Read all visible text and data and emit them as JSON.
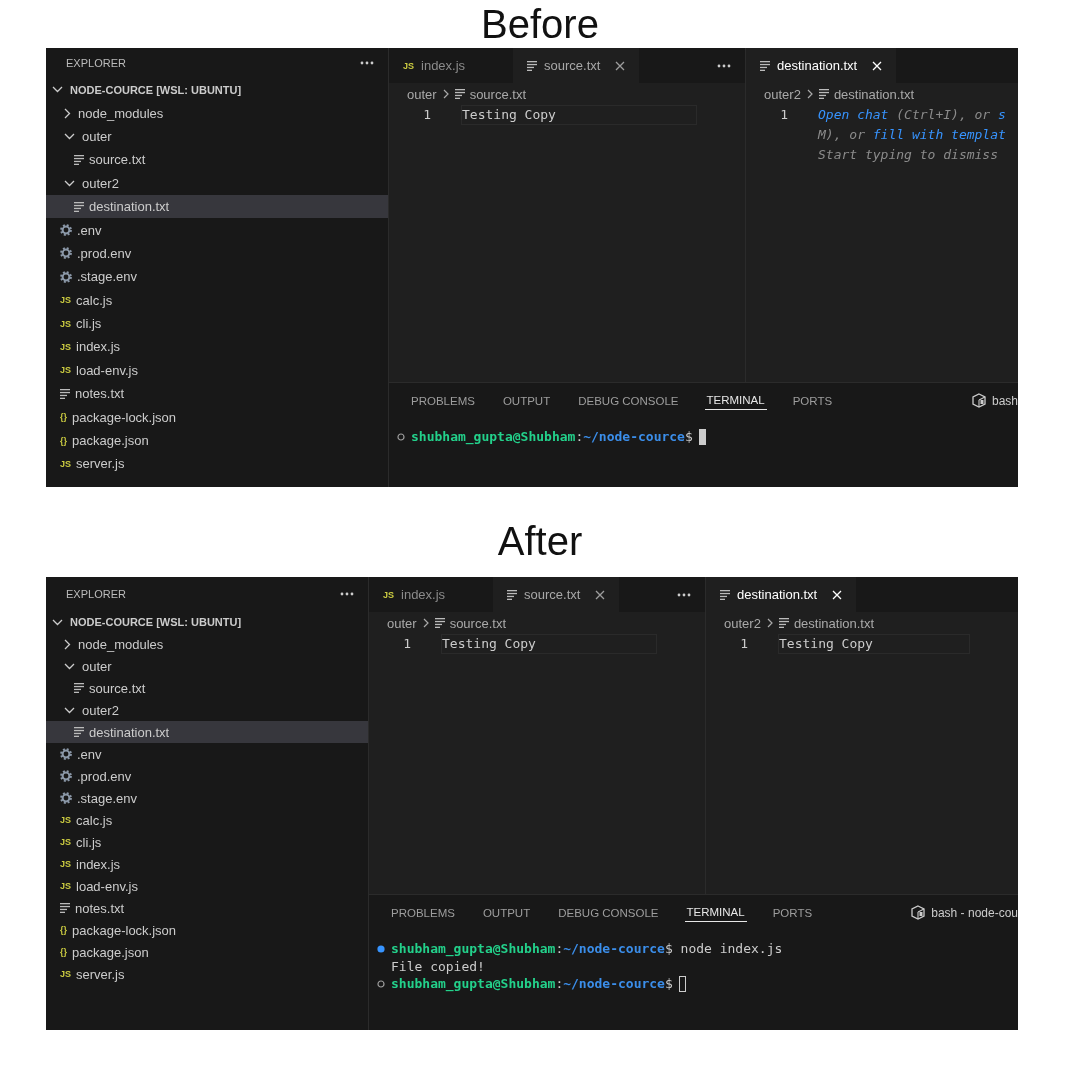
{
  "panels": [
    {
      "caption": "Before",
      "explorer": {
        "title": "EXPLORER",
        "tree": [
          {
            "name": "NODE-COURCE [WSL: UBUNTU]",
            "kind": "root",
            "expanded": true,
            "selected": false,
            "children": [
              {
                "name": "node_modules",
                "kind": "folder",
                "expanded": false,
                "selected": false
              },
              {
                "name": "outer",
                "kind": "folder",
                "expanded": true,
                "selected": false,
                "children": [
                  {
                    "name": "source.txt",
                    "kind": "text",
                    "selected": false
                  }
                ]
              },
              {
                "name": "outer2",
                "kind": "folder",
                "expanded": true,
                "selected": false,
                "children": [
                  {
                    "name": "destination.txt",
                    "kind": "text",
                    "selected": true
                  }
                ]
              },
              {
                "name": ".env",
                "kind": "env",
                "selected": false
              },
              {
                "name": ".prod.env",
                "kind": "env",
                "selected": false
              },
              {
                "name": ".stage.env",
                "kind": "env",
                "selected": false
              },
              {
                "name": "calc.js",
                "kind": "js",
                "badge": "JS",
                "selected": false
              },
              {
                "name": "cli.js",
                "kind": "js",
                "badge": "JS",
                "selected": false
              },
              {
                "name": "index.js",
                "kind": "js",
                "badge": "JS",
                "selected": false
              },
              {
                "name": "load-env.js",
                "kind": "js",
                "badge": "JS",
                "selected": false
              },
              {
                "name": "notes.txt",
                "kind": "text",
                "selected": false
              },
              {
                "name": "package-lock.json",
                "kind": "json",
                "badge": "{}",
                "selected": false
              },
              {
                "name": "package.json",
                "kind": "json",
                "badge": "{}",
                "selected": false
              },
              {
                "name": "server.js",
                "kind": "js",
                "badge": "JS",
                "selected": false
              }
            ]
          }
        ]
      },
      "editors": [
        {
          "focused": false,
          "more_menu": true,
          "tabs": [
            {
              "label": "index.js",
              "kind": "js",
              "badge": "JS",
              "selected": false
            },
            {
              "label": "source.txt",
              "kind": "text",
              "selected": true
            }
          ],
          "breadcrumb": [
            {
              "label": "outer",
              "kind": "folder"
            },
            {
              "label": "source.txt",
              "kind": "text"
            }
          ],
          "lines": [
            {
              "number": "1",
              "kind": "code",
              "text": "Testing Copy"
            }
          ]
        },
        {
          "focused": true,
          "tabs": [
            {
              "label": "destination.txt",
              "kind": "text",
              "selected": true
            }
          ],
          "breadcrumb": [
            {
              "label": "outer2",
              "kind": "folder"
            },
            {
              "label": "destination.txt",
              "kind": "text"
            }
          ],
          "lines": [
            {
              "number": "1",
              "kind": "hint",
              "rows": [
                [
                  {
                    "text": "Open chat",
                    "link": true
                  },
                  {
                    "text": " (Ctrl+I), or ",
                    "link": false
                  },
                  {
                    "text": "s",
                    "link": true
                  }
                ],
                [
                  {
                    "text": "M), or ",
                    "link": false
                  },
                  {
                    "text": "fill with templat",
                    "link": true
                  }
                ],
                [
                  {
                    "text": "Start typing to dismiss",
                    "link": false
                  }
                ]
              ]
            }
          ]
        }
      ],
      "panel": {
        "tabs": [
          {
            "label": "PROBLEMS",
            "selected": false
          },
          {
            "label": "OUTPUT",
            "selected": false
          },
          {
            "label": "DEBUG CONSOLE",
            "selected": false
          },
          {
            "label": "TERMINAL",
            "selected": true
          },
          {
            "label": "PORTS",
            "selected": false
          }
        ],
        "shell": "bash",
        "lines": [
          {
            "kind": "prompt",
            "completed": false,
            "user": "shubham_gupta@Shubham",
            "separator": ":",
            "path": "~/node-cource",
            "prompt": "$",
            "cursor": {
              "focused": true
            }
          }
        ]
      }
    },
    {
      "caption": "After",
      "explorer": {
        "title": "EXPLORER",
        "tree": [
          {
            "name": "NODE-COURCE [WSL: UBUNTU]",
            "kind": "root",
            "expanded": true,
            "selected": false,
            "children": [
              {
                "name": "node_modules",
                "kind": "folder",
                "expanded": false,
                "selected": false
              },
              {
                "name": "outer",
                "kind": "folder",
                "expanded": true,
                "selected": false,
                "children": [
                  {
                    "name": "source.txt",
                    "kind": "text",
                    "selected": false
                  }
                ]
              },
              {
                "name": "outer2",
                "kind": "folder",
                "expanded": true,
                "selected": false,
                "children": [
                  {
                    "name": "destination.txt",
                    "kind": "text",
                    "selected": true
                  }
                ]
              },
              {
                "name": ".env",
                "kind": "env",
                "selected": false
              },
              {
                "name": ".prod.env",
                "kind": "env",
                "selected": false
              },
              {
                "name": ".stage.env",
                "kind": "env",
                "selected": false
              },
              {
                "name": "calc.js",
                "kind": "js",
                "badge": "JS",
                "selected": false
              },
              {
                "name": "cli.js",
                "kind": "js",
                "badge": "JS",
                "selected": false
              },
              {
                "name": "index.js",
                "kind": "js",
                "badge": "JS",
                "selected": false
              },
              {
                "name": "load-env.js",
                "kind": "js",
                "badge": "JS",
                "selected": false
              },
              {
                "name": "notes.txt",
                "kind": "text",
                "selected": false
              },
              {
                "name": "package-lock.json",
                "kind": "json",
                "badge": "{}",
                "selected": false
              },
              {
                "name": "package.json",
                "kind": "json",
                "badge": "{}",
                "selected": false
              },
              {
                "name": "server.js",
                "kind": "js",
                "badge": "JS",
                "selected": false
              }
            ]
          }
        ]
      },
      "editors": [
        {
          "focused": false,
          "more_menu": true,
          "tabs": [
            {
              "label": "index.js",
              "kind": "js",
              "badge": "JS",
              "selected": false
            },
            {
              "label": "source.txt",
              "kind": "text",
              "selected": true
            }
          ],
          "breadcrumb": [
            {
              "label": "outer",
              "kind": "folder"
            },
            {
              "label": "source.txt",
              "kind": "text"
            }
          ],
          "lines": [
            {
              "number": "1",
              "kind": "code",
              "text": "Testing Copy"
            }
          ]
        },
        {
          "focused": true,
          "tabs": [
            {
              "label": "destination.txt",
              "kind": "text",
              "selected": true
            }
          ],
          "breadcrumb": [
            {
              "label": "outer2",
              "kind": "folder"
            },
            {
              "label": "destination.txt",
              "kind": "text"
            }
          ],
          "lines": [
            {
              "number": "1",
              "kind": "code",
              "text": "Testing Copy"
            }
          ]
        }
      ],
      "panel": {
        "tabs": [
          {
            "label": "PROBLEMS",
            "selected": false
          },
          {
            "label": "OUTPUT",
            "selected": false
          },
          {
            "label": "DEBUG CONSOLE",
            "selected": false
          },
          {
            "label": "TERMINAL",
            "selected": true
          },
          {
            "label": "PORTS",
            "selected": false
          }
        ],
        "shell": "bash - node-cou",
        "lines": [
          {
            "kind": "prompt",
            "completed": true,
            "user": "shubham_gupta@Shubham",
            "separator": ":",
            "path": "~/node-cource",
            "prompt": "$",
            "command": "node index.js"
          },
          {
            "kind": "output",
            "text": "File copied!"
          },
          {
            "kind": "prompt",
            "completed": false,
            "user": "shubham_gupta@Shubham",
            "separator": ":",
            "path": "~/node-cource",
            "prompt": "$",
            "cursor": {
              "focused": false
            }
          }
        ]
      }
    }
  ]
}
